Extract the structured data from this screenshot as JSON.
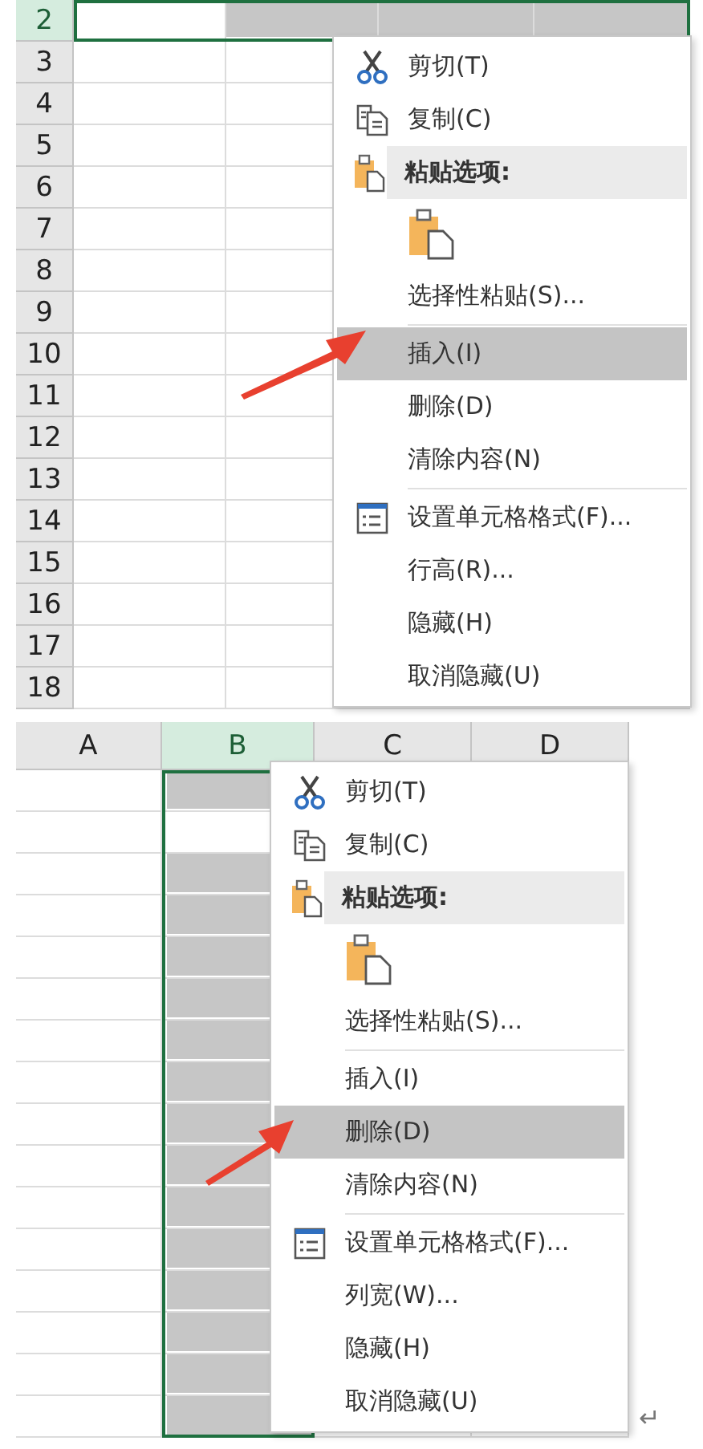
{
  "sheets": [
    {
      "kind": "rows",
      "headers": [
        {
          "label": "2",
          "selected": true,
          "shaded": [
            false,
            true,
            true,
            true
          ]
        },
        {
          "label": "3",
          "selected": false,
          "shaded": [
            false,
            false
          ]
        },
        {
          "label": "4",
          "selected": false,
          "shaded": [
            false,
            false
          ]
        },
        {
          "label": "5",
          "selected": false,
          "shaded": [
            false,
            false
          ]
        },
        {
          "label": "6",
          "selected": false,
          "shaded": [
            false,
            false
          ]
        },
        {
          "label": "7",
          "selected": false,
          "shaded": [
            false,
            false
          ]
        },
        {
          "label": "8",
          "selected": false,
          "shaded": [
            false,
            false
          ]
        },
        {
          "label": "9",
          "selected": false,
          "shaded": [
            false,
            false
          ]
        },
        {
          "label": "10",
          "selected": false,
          "shaded": [
            false,
            false
          ]
        },
        {
          "label": "11",
          "selected": false,
          "shaded": [
            false,
            false
          ]
        },
        {
          "label": "12",
          "selected": false,
          "shaded": [
            false,
            false
          ]
        },
        {
          "label": "13",
          "selected": false,
          "shaded": [
            false,
            false
          ]
        },
        {
          "label": "14",
          "selected": false,
          "shaded": [
            false,
            false
          ]
        },
        {
          "label": "15",
          "selected": false,
          "shaded": [
            false,
            false
          ]
        },
        {
          "label": "16",
          "selected": false,
          "shaded": [
            false,
            false
          ]
        },
        {
          "label": "17",
          "selected": false,
          "shaded": [
            false,
            false
          ]
        },
        {
          "label": "18",
          "selected": false,
          "shaded": [
            false,
            false
          ]
        }
      ],
      "menu": [
        {
          "kind": "cut",
          "label": "剪切(T)",
          "selected": false
        },
        {
          "kind": "copy",
          "label": "复制(C)",
          "selected": false
        },
        {
          "kind": "header",
          "label": "粘贴选项:"
        },
        {
          "kind": "paste-button"
        },
        {
          "kind": "plain",
          "label": "选择性粘贴(S)...",
          "selected": false
        },
        {
          "kind": "separator"
        },
        {
          "kind": "plain",
          "label": "插入(I)",
          "selected": true
        },
        {
          "kind": "plain",
          "label": "删除(D)",
          "selected": false
        },
        {
          "kind": "plain",
          "label": "清除内容(N)",
          "selected": false
        },
        {
          "kind": "separator"
        },
        {
          "kind": "format",
          "label": "设置单元格格式(F)...",
          "selected": false
        },
        {
          "kind": "plain",
          "label": "行高(R)...",
          "selected": false
        },
        {
          "kind": "plain",
          "label": "隐藏(H)",
          "selected": false
        },
        {
          "kind": "plain",
          "label": "取消隐藏(U)",
          "selected": false
        }
      ]
    },
    {
      "kind": "columns",
      "headers": [
        {
          "label": "A",
          "selected": false,
          "shaded": [
            false,
            false,
            false,
            false,
            false,
            false,
            false,
            false,
            false,
            false,
            false,
            false,
            false,
            false,
            false,
            false
          ]
        },
        {
          "label": "B",
          "selected": true,
          "shaded": [
            true,
            false,
            true,
            true,
            true,
            true,
            true,
            true,
            true,
            true,
            true,
            true,
            true,
            true,
            true,
            true
          ]
        },
        {
          "label": "C",
          "selected": false
        },
        {
          "label": "D",
          "selected": false
        }
      ],
      "menu": [
        {
          "kind": "cut",
          "label": "剪切(T)",
          "selected": false
        },
        {
          "kind": "copy",
          "label": "复制(C)",
          "selected": false
        },
        {
          "kind": "header",
          "label": "粘贴选项:"
        },
        {
          "kind": "paste-button"
        },
        {
          "kind": "plain",
          "label": "选择性粘贴(S)...",
          "selected": false
        },
        {
          "kind": "separator"
        },
        {
          "kind": "plain",
          "label": "插入(I)",
          "selected": false
        },
        {
          "kind": "plain",
          "label": "删除(D)",
          "selected": true
        },
        {
          "kind": "plain",
          "label": "清除内容(N)",
          "selected": false
        },
        {
          "kind": "separator"
        },
        {
          "kind": "format",
          "label": "设置单元格格式(F)...",
          "selected": false
        },
        {
          "kind": "plain",
          "label": "列宽(W)...",
          "selected": false
        },
        {
          "kind": "plain",
          "label": "隐藏(H)",
          "selected": false
        },
        {
          "kind": "plain",
          "label": "取消隐藏(U)",
          "selected": false
        }
      ],
      "return_mark": "↵"
    }
  ]
}
